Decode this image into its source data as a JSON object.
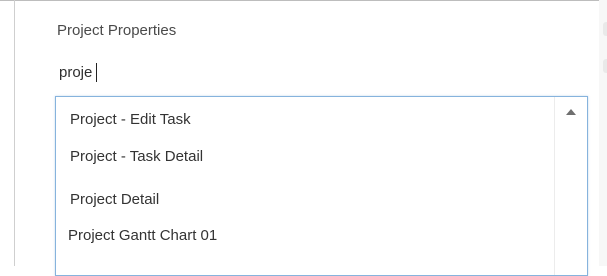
{
  "section": {
    "title": "Project Properties"
  },
  "search": {
    "value": "proje"
  },
  "dropdown": {
    "items": [
      {
        "label": "Project - Edit Task"
      },
      {
        "label": "Project - Task Detail"
      },
      {
        "label": "Project Detail"
      },
      {
        "label": "Project Gantt Chart 01"
      }
    ]
  },
  "icons": {
    "scroll_up": "chevron-up-icon"
  },
  "colors": {
    "dropdown_border": "#86b3dd",
    "text": "#333333",
    "scroll_arrow": "#6f6f6f"
  }
}
